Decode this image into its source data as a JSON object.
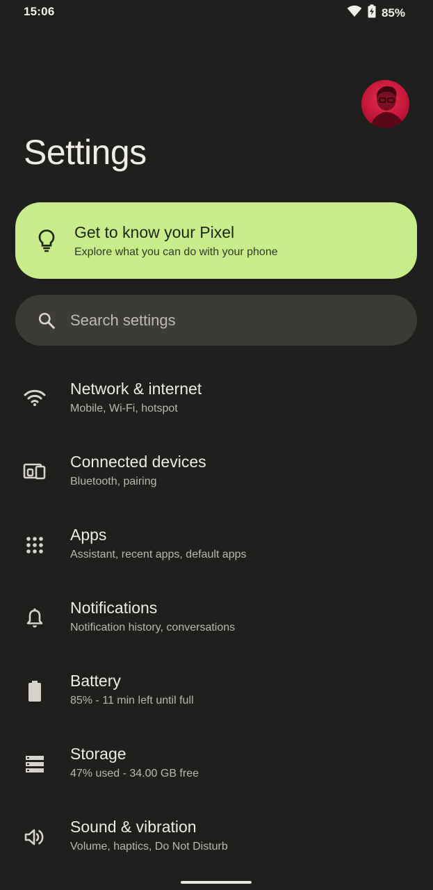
{
  "status_bar": {
    "time": "15:06",
    "battery_percent": "85%",
    "icons": [
      "wifi-icon",
      "battery-charging-icon"
    ]
  },
  "header": {
    "title": "Settings",
    "avatar": "profile-avatar"
  },
  "tip_card": {
    "title": "Get to know your Pixel",
    "subtitle": "Explore what you can do with your phone",
    "icon": "lightbulb-icon"
  },
  "search": {
    "placeholder": "Search settings",
    "icon": "search-icon"
  },
  "settings": [
    {
      "title": "Network & internet",
      "subtitle": "Mobile, Wi‑Fi, hotspot",
      "icon": "wifi-icon"
    },
    {
      "title": "Connected devices",
      "subtitle": "Bluetooth, pairing",
      "icon": "devices-icon"
    },
    {
      "title": "Apps",
      "subtitle": "Assistant, recent apps, default apps",
      "icon": "apps-grid-icon"
    },
    {
      "title": "Notifications",
      "subtitle": "Notification history, conversations",
      "icon": "bell-icon"
    },
    {
      "title": "Battery",
      "subtitle": "85% - 11 min left until full",
      "icon": "battery-icon"
    },
    {
      "title": "Storage",
      "subtitle": "47% used - 34.00 GB free",
      "icon": "storage-icon"
    },
    {
      "title": "Sound & vibration",
      "subtitle": "Volume, haptics, Do Not Disturb",
      "icon": "volume-icon"
    }
  ],
  "colors": {
    "background": "#1f1f1d",
    "tip_card": "#c8ec8a",
    "search_bar": "#3c3b38",
    "avatar": "#c5173b"
  }
}
